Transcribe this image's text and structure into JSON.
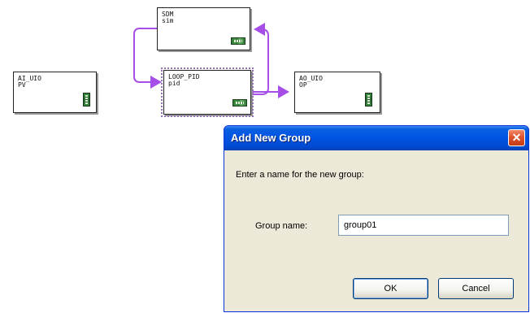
{
  "diagram": {
    "blocks": {
      "sdm": {
        "name": "SDM",
        "sub": "sim"
      },
      "ai": {
        "name": "AI_UIO",
        "sub": "PV"
      },
      "loop": {
        "name": "LOOP_PID",
        "sub": "pid"
      },
      "ao": {
        "name": "AO_UIO",
        "sub": "OP"
      }
    },
    "link_color": "#a64ee8"
  },
  "dialog": {
    "title": "Add New Group",
    "close_icon": "close-x",
    "prompt": "Enter a name for the new group:",
    "group_label": "Group name:",
    "group_value": "group01",
    "ok_label": "OK",
    "cancel_label": "Cancel"
  }
}
